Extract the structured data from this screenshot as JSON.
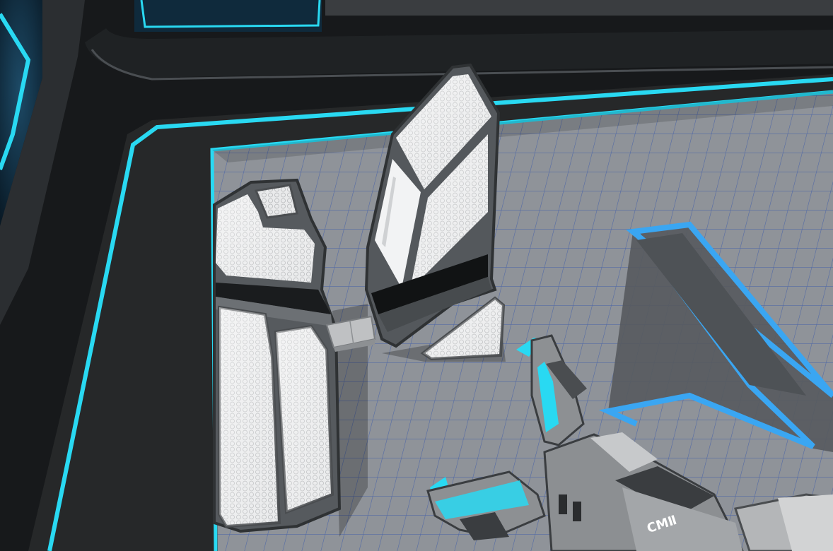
{
  "scene": {
    "label": "",
    "tool_badge": "CMⅡ",
    "colors": {
      "accent": "#29d9f2",
      "accent_blue": "#3aa6f2",
      "floor": "#8f9399",
      "grid": "#3d5aa8",
      "frame": "#262829",
      "wall": "#17191b",
      "panel_white": "#e6e7e8",
      "panel_gray": "#6b6e71",
      "tool_body": "#8c8f92"
    }
  }
}
